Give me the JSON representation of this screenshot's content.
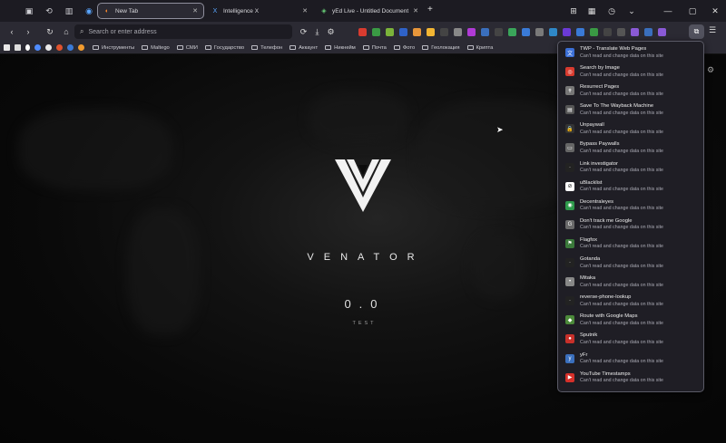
{
  "tabs": [
    {
      "label": "New Tab",
      "active": true
    },
    {
      "label": "Intelligence X",
      "active": false
    },
    {
      "label": "yEd Live - Untitled Document",
      "active": false
    }
  ],
  "urlbar": {
    "placeholder": "Search or enter address"
  },
  "bookmarks": [
    "Инструменты",
    "Maltego",
    "СМИ",
    "Государство",
    "Телефон",
    "Аккаунт",
    "Никнейм",
    "Почта",
    "Фото",
    "Геолокация",
    "Крипта"
  ],
  "page": {
    "brand": "VENATOR",
    "version": "0.0",
    "tagline": "TEST"
  },
  "extensions": {
    "access_text": "Can't read and change data on this site",
    "items": [
      {
        "name": "TWP - Translate Web Pages",
        "color": "#3b6fd6",
        "glyph": "文"
      },
      {
        "name": "Search by Image",
        "color": "#d83b2f",
        "glyph": "◎"
      },
      {
        "name": "Resurrect Pages",
        "color": "#777777",
        "glyph": "✝"
      },
      {
        "name": "Save To The Wayback Machine",
        "color": "#555555",
        "glyph": "▤"
      },
      {
        "name": "Unpaywall",
        "color": "#333333",
        "glyph": "🔒"
      },
      {
        "name": "Bypass Paywalls",
        "color": "#666666",
        "glyph": "▭"
      },
      {
        "name": "Link investigator",
        "color": "#222222",
        "glyph": "·"
      },
      {
        "name": "uBlacklist",
        "color": "#ffffff",
        "glyph": "⊘"
      },
      {
        "name": "Decentraleyes",
        "color": "#2e9a4b",
        "glyph": "◉"
      },
      {
        "name": "Don't track me Google",
        "color": "#6a6a6a",
        "glyph": "G"
      },
      {
        "name": "Flagfox",
        "color": "#3b7a3b",
        "glyph": "⚑"
      },
      {
        "name": "Gotanda",
        "color": "#222222",
        "glyph": "·"
      },
      {
        "name": "Mitaka",
        "color": "#888888",
        "glyph": "•"
      },
      {
        "name": "reverse-phone-lookup",
        "color": "#222222",
        "glyph": "·"
      },
      {
        "name": "Route with Google Maps",
        "color": "#4c8a3a",
        "glyph": "◆"
      },
      {
        "name": "Sputnik",
        "color": "#c8302a",
        "glyph": "●"
      },
      {
        "name": "yFr",
        "color": "#3a6fbd",
        "glyph": "y"
      },
      {
        "name": "YouTube Timestamps",
        "color": "#d6302a",
        "glyph": "▶"
      }
    ]
  },
  "toolbar_extension_colors": [
    "#d83b2f",
    "#3a9a44",
    "#7bb33a",
    "#2f62c7",
    "#e8963a",
    "#f2b533",
    "#444444",
    "#888888",
    "#b03ad6",
    "#3a6fbd",
    "#444444",
    "#3aa55a",
    "#3a7ad6",
    "#7a7a7a",
    "#2f88c7",
    "#6b3ad6",
    "#3a7ad6",
    "#3a9a44",
    "#444444",
    "#555555",
    "#8a5ad6",
    "#3a6fbd",
    "#8a5ad6"
  ]
}
